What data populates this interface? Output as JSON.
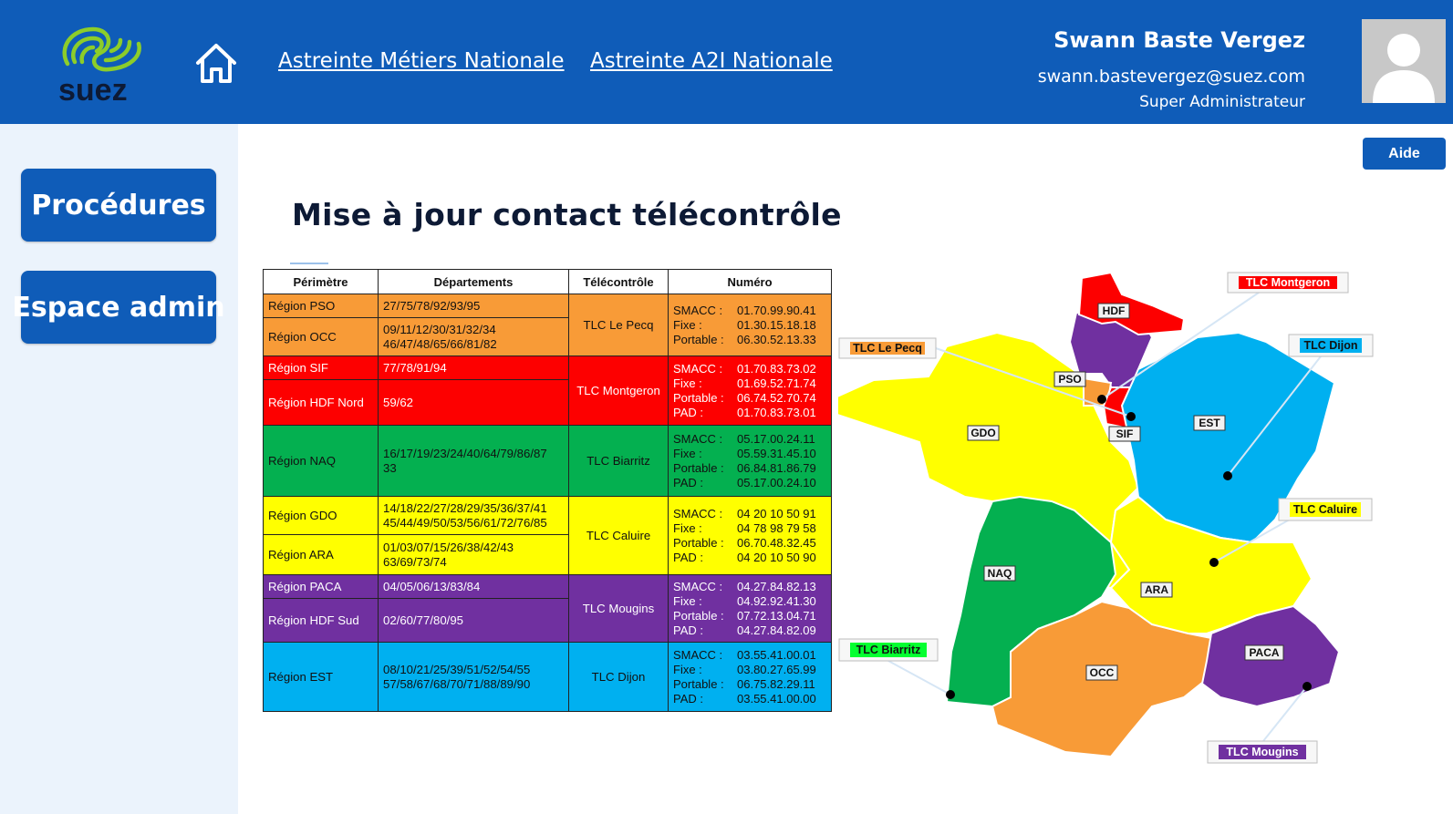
{
  "header": {
    "logo_text": "suez",
    "nav_links": [
      "Astreinte Métiers Nationale",
      "Astreinte A2I Nationale"
    ],
    "user": {
      "name": "Swann Baste Vergez",
      "email": "swann.bastevergez@suez.com",
      "role": "Super Administrateur"
    }
  },
  "sidebar": {
    "buttons": [
      "Procédures",
      "Espace admin"
    ]
  },
  "aide_label": "Aide",
  "page_title": "Mise à jour contact télécontrôle",
  "table": {
    "headers": [
      "Périmètre",
      "Départements",
      "Télécontrôle",
      "Numéro"
    ],
    "groups": [
      {
        "color": "orange",
        "tlc": "TLC Le Pecq",
        "rows": [
          {
            "region": "Région PSO",
            "depts": [
              "27/75/78/92/93/95"
            ]
          },
          {
            "region": "Région OCC",
            "depts": [
              "09/11/12/30/31/32/34",
              "46/47/48/65/66/81/82"
            ]
          }
        ],
        "numbers": [
          {
            "label": "SMACC :",
            "value": "01.70.99.90.41"
          },
          {
            "label": "Fixe :",
            "value": "01.30.15.18.18"
          },
          {
            "label": "Portable :",
            "value": "06.30.52.13.33"
          }
        ]
      },
      {
        "color": "red",
        "tlc": "TLC Montgeron",
        "rows": [
          {
            "region": "Région SIF",
            "depts": [
              "77/78/91/94"
            ]
          },
          {
            "region": "Région HDF Nord",
            "depts": [
              "59/62"
            ]
          }
        ],
        "numbers": [
          {
            "label": "SMACC :",
            "value": "01.70.83.73.02"
          },
          {
            "label": "Fixe :",
            "value": "01.69.52.71.74"
          },
          {
            "label": "Portable :",
            "value": "06.74.52.70.74"
          },
          {
            "label": "PAD :",
            "value": "01.70.83.73.01"
          }
        ]
      },
      {
        "color": "green",
        "tlc": "TLC Biarritz",
        "rows": [
          {
            "region": "Région NAQ",
            "depts": [
              "16/17/19/23/24/40/64/79/86/87",
              "33"
            ]
          }
        ],
        "numbers": [
          {
            "label": "SMACC :",
            "value": "05.17.00.24.11"
          },
          {
            "label": "Fixe :",
            "value": "05.59.31.45.10"
          },
          {
            "label": "Portable :",
            "value": "06.84.81.86.79"
          },
          {
            "label": "PAD :",
            "value": "05.17.00.24.10"
          }
        ]
      },
      {
        "color": "yellow",
        "tlc": "TLC Caluire",
        "rows": [
          {
            "region": "Région GDO",
            "depts": [
              "14/18/22/27/28/29/35/36/37/41",
              "45/44/49/50/53/56/61/72/76/85"
            ]
          },
          {
            "region": "Région ARA",
            "depts": [
              "01/03/07/15/26/38/42/43",
              "63/69/73/74"
            ]
          }
        ],
        "numbers": [
          {
            "label": "SMACC :",
            "value": "04 20 10 50 91"
          },
          {
            "label": "Fixe :",
            "value": "04 78 98 79 58"
          },
          {
            "label": "Portable :",
            "value": "06.70.48.32.45"
          },
          {
            "label": "PAD :",
            "value": "04 20 10 50 90"
          }
        ]
      },
      {
        "color": "purple",
        "tlc": "TLC Mougins",
        "rows": [
          {
            "region": "Région PACA",
            "depts": [
              "04/05/06/13/83/84"
            ]
          },
          {
            "region": "Région HDF Sud",
            "depts": [
              "02/60/77/80/95"
            ]
          }
        ],
        "numbers": [
          {
            "label": "SMACC :",
            "value": "04.27.84.82.13"
          },
          {
            "label": "Fixe :",
            "value": "04.92.92.41.30"
          },
          {
            "label": "Portable :",
            "value": "07.72.13.04.71"
          },
          {
            "label": "PAD :",
            "value": "04.27.84.82.09"
          }
        ]
      },
      {
        "color": "cyan",
        "tlc": "TLC Dijon",
        "rows": [
          {
            "region": "Région EST",
            "depts": [
              "08/10/21/25/39/51/52/54/55",
              "57/58/67/68/70/71/88/89/90"
            ]
          }
        ],
        "numbers": [
          {
            "label": "SMACC :",
            "value": "03.55.41.00.01"
          },
          {
            "label": "Fixe :",
            "value": "03.80.27.65.99"
          },
          {
            "label": "Portable :",
            "value": "06.75.82.29.11"
          },
          {
            "label": "PAD :",
            "value": "03.55.41.00.00"
          }
        ]
      }
    ]
  },
  "map": {
    "region_labels": [
      "HDF",
      "PSO",
      "SIF",
      "GDO",
      "EST",
      "NAQ",
      "ARA",
      "OCC",
      "PACA"
    ],
    "tlc_labels": [
      "TLC Montgeron",
      "TLC Le Pecq",
      "TLC Dijon",
      "TLC Caluire",
      "TLC Biarritz",
      "TLC Mougins"
    ],
    "colors": {
      "orange": "#f89b37",
      "red": "#fd0000",
      "green": "#04b050",
      "yellow": "#ffff00",
      "purple": "#7030a0",
      "cyan": "#00b0f0"
    }
  }
}
